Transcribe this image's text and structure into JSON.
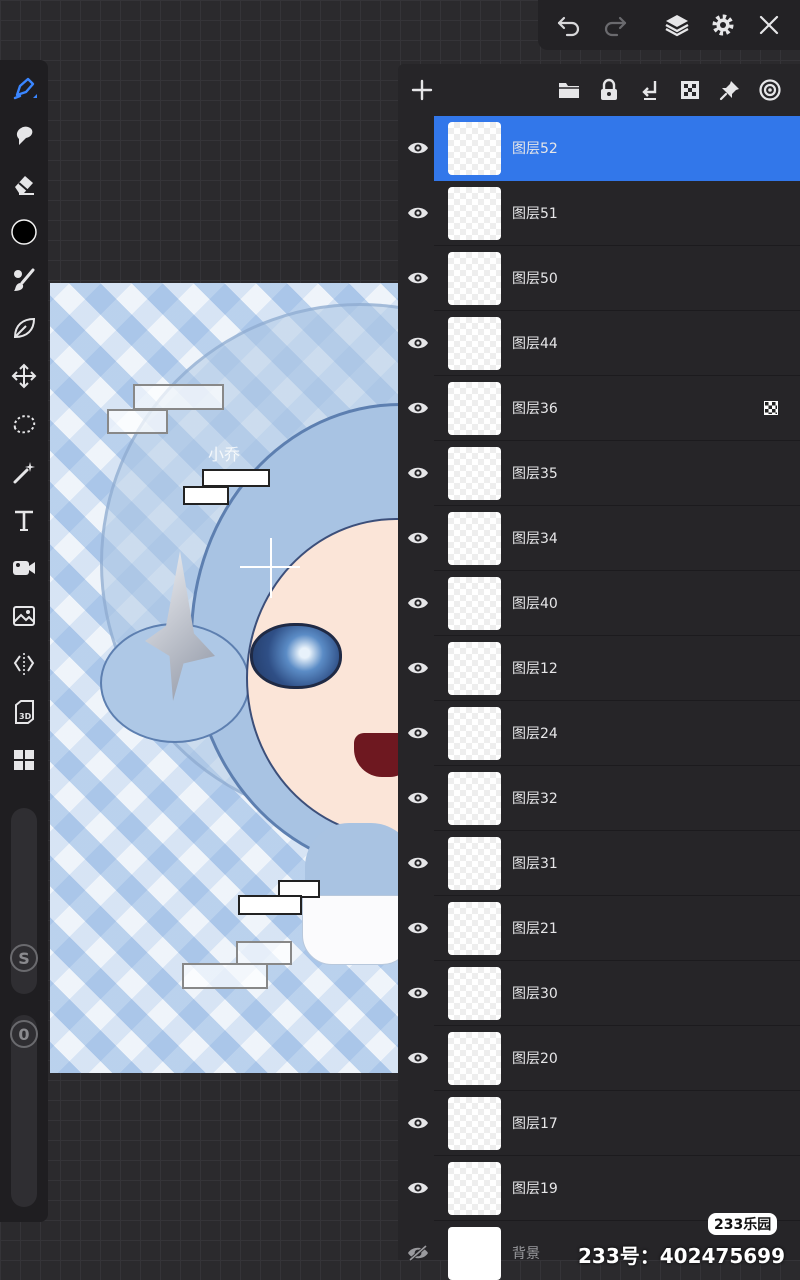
{
  "toolbar_top": {
    "icons": [
      "undo-icon",
      "redo-icon",
      "layers-icon",
      "settings-icon",
      "close-icon"
    ]
  },
  "tools": {
    "items": [
      "brush-icon",
      "smudge-icon",
      "eraser-icon",
      "color-swatch",
      "paint-icon",
      "leaf-icon",
      "transform-icon",
      "lasso-icon",
      "magic-wand-icon",
      "text-icon",
      "video-icon",
      "image-import-icon",
      "symmetry-icon",
      "3d-icon",
      "grid-icon"
    ],
    "color": "#000000",
    "size_label": "S",
    "opacity_label": "0"
  },
  "artwork": {
    "signature": "小乔"
  },
  "layers_panel": {
    "header_icons": [
      "add-layer-icon",
      "folder-icon",
      "lock-icon",
      "merge-down-icon",
      "alpha-lock-icon",
      "pin-icon",
      "reference-icon"
    ],
    "layers": [
      {
        "name": "图层52",
        "active": true
      },
      {
        "name": "图层51"
      },
      {
        "name": "图层50"
      },
      {
        "name": "图层44"
      },
      {
        "name": "图层36",
        "alpha_lock": true
      },
      {
        "name": "图层35"
      },
      {
        "name": "图层34"
      },
      {
        "name": "图层40"
      },
      {
        "name": "图层12"
      },
      {
        "name": "图层24"
      },
      {
        "name": "图层32"
      },
      {
        "name": "图层31"
      },
      {
        "name": "图层21"
      },
      {
        "name": "图层30"
      },
      {
        "name": "图层20"
      },
      {
        "name": "图层17"
      },
      {
        "name": "图层19"
      },
      {
        "name": "背景",
        "hidden": true
      }
    ],
    "accent": "#3277ea"
  },
  "watermark": {
    "badge": "233乐园",
    "id_text": "233号：402475699"
  }
}
